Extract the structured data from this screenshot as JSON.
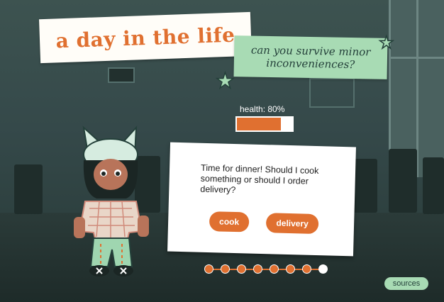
{
  "header": {
    "title": "a day in the life",
    "subtitle": "can you survive minor inconveniences?"
  },
  "health": {
    "label": "health: 80%",
    "percent": 80
  },
  "dialog": {
    "text": "Time for dinner! Should I cook something or should I order delivery?",
    "options": [
      "cook",
      "delivery"
    ]
  },
  "progress": {
    "total_steps": 8,
    "current_step": 8
  },
  "footer": {
    "sources_label": "sources"
  },
  "colors": {
    "accent_orange": "#e07030",
    "mint": "#a8dbb4",
    "background": "#2c3f3c"
  },
  "icons": [
    "star-icon",
    "character-illustration"
  ]
}
